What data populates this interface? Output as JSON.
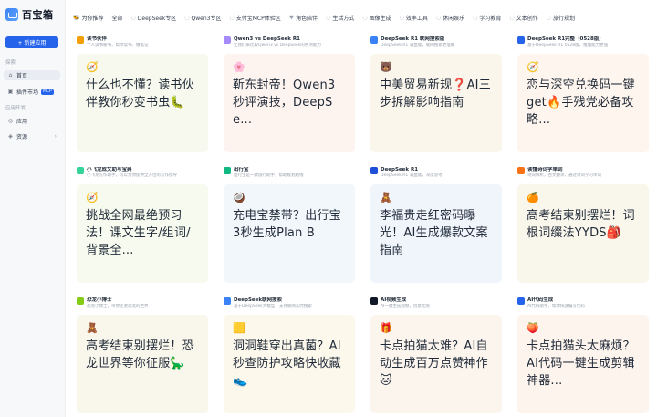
{
  "app": {
    "name": "百宝箱",
    "brand_color": "#2563eb"
  },
  "sidebar": {
    "new_button": "+ 新建应用",
    "section_explore": "探索",
    "items_explore": [
      {
        "label": "首页",
        "icon": "home-icon",
        "active": true
      },
      {
        "label": "插件市场",
        "icon": "plugin-icon",
        "badge": "MCP"
      }
    ],
    "section_dev": "应用开发",
    "items_dev": [
      {
        "label": "应用",
        "icon": "app-icon"
      },
      {
        "label": "资源",
        "icon": "resource-icon",
        "arrow": "›"
      }
    ]
  },
  "categories": [
    {
      "label": "为你推荐",
      "icon": "🐝"
    },
    {
      "label": "全部",
      "icon": ""
    },
    {
      "label": "DeepSeek专区",
      "icon": "◌"
    },
    {
      "label": "Qwen3专区",
      "icon": "◌"
    },
    {
      "label": "支付宝MCP体验区",
      "icon": "◌"
    },
    {
      "label": "角色陪伴",
      "icon": "♥"
    },
    {
      "label": "生活方式",
      "icon": "◌"
    },
    {
      "label": "图像生成",
      "icon": "◌"
    },
    {
      "label": "效率工具",
      "icon": "◌"
    },
    {
      "label": "休闲娱乐",
      "icon": "◌"
    },
    {
      "label": "学习教育",
      "icon": "◌"
    },
    {
      "label": "文本创作",
      "icon": "◌"
    },
    {
      "label": "旅行规划",
      "icon": "◌"
    }
  ],
  "cards": [
    {
      "title": "读书伙伴",
      "desc": "个人读书秘书，帮你读书、做笔记",
      "avatar_color": "#f59e0b",
      "cover_bg": "#f7f9ee",
      "emoji": "🧭",
      "text": "什么也不懂？读书伙伴教你秒变书虫🐛"
    },
    {
      "title": "Qwen3 vs DeepSeek R1",
      "desc": "让我们来比较Qwen3 vs DeepSeek的各项能力",
      "avatar_color": "#a78bfa",
      "cover_bg": "#fdf4f0",
      "emoji": "🌸",
      "text": "靳东封帝！Qwen3秒评演技，DeepSe..."
    },
    {
      "title": "DeepSeek R1 联网搜索版",
      "desc": "DeepSeek R1 满血版，联网搜索更准确",
      "avatar_color": "#3b82f6",
      "cover_bg": "#fbf6ec",
      "emoji": "🐻",
      "text": "中美贸易新规❓AI三步拆解影响指南"
    },
    {
      "title": "DeepSeek R1完整（0528版）",
      "desc": "基于DeepSeek R1 0528版，推理能力更强",
      "avatar_color": "#2563eb",
      "cover_bg": "#fdf5ee",
      "emoji": "🧭",
      "text": "恋与深空兑换码一键get🔥手残党必备攻略..."
    },
    {
      "title": "小飞龙成文助写宝典",
      "desc": "小飞龙写作助手，可以为你提供全方位的写作指导",
      "avatar_color": "#34d399",
      "cover_bg": "#f7faee",
      "emoji": "🧭",
      "text": "挑战全网最绝预习法！课文生字/组词/背景全..."
    },
    {
      "title": "出行宝",
      "desc": "出行宝是一款旅行助手，帮助规划路线",
      "avatar_color": "#10b981",
      "cover_bg": "#f2f7fb",
      "emoji": "🥥",
      "text": "充电宝禁带？出行宝3秒生成Plan B"
    },
    {
      "title": "DeepSeek R1",
      "desc": "DeepSeek R1 满血版，深度思考",
      "avatar_color": "#1d4ed8",
      "cover_bg": "#f0f5fc",
      "emoji": "🧸",
      "text": "李福贵走红密码曝光！AI生成爆款文案指南"
    },
    {
      "title": "读懂诗词学单词",
      "desc": "诗词解析，古文翻译，通过诗词学习单词",
      "avatar_color": "#f97316",
      "cover_bg": "#f9f6ec",
      "emoji": "🍊",
      "text": "高考结束别摆烂！词根词缀法YYDS🎒"
    },
    {
      "title": "恐龙小博士",
      "desc": "恐龙小博士，带你走进恐龙的世界",
      "avatar_color": "#84cc16",
      "cover_bg": "#f9f7ec",
      "emoji": "🧸",
      "text": "高考结束别摆烂！恐龙世界等你征服🦕"
    },
    {
      "title": "DeepSeek联网搜索",
      "desc": "基于DeepSeek大模型，支持联网实时搜索",
      "avatar_color": "#3b82f6",
      "cover_bg": "#fcf8ec",
      "emoji": "🟨",
      "text": "洞洞鞋穿出真菌？AI秒查防护攻略快收藏👟"
    },
    {
      "title": "AI视频生成",
      "desc": "AI一键生成视频，创意无限",
      "avatar_color": "#111827",
      "cover_bg": "#fbf5ee",
      "emoji": "🎁",
      "text": "卡点拍猫太难？AI自动生成百万点赞神作🐱"
    },
    {
      "title": "AI代码生成",
      "desc": "AI代码助手，帮你快速编写代码",
      "avatar_color": "#2563eb",
      "cover_bg": "#fdf4ee",
      "emoji": "🍑",
      "text": "卡点拍猫头太麻烦？AI代码一键生成剪辑神器..."
    }
  ]
}
